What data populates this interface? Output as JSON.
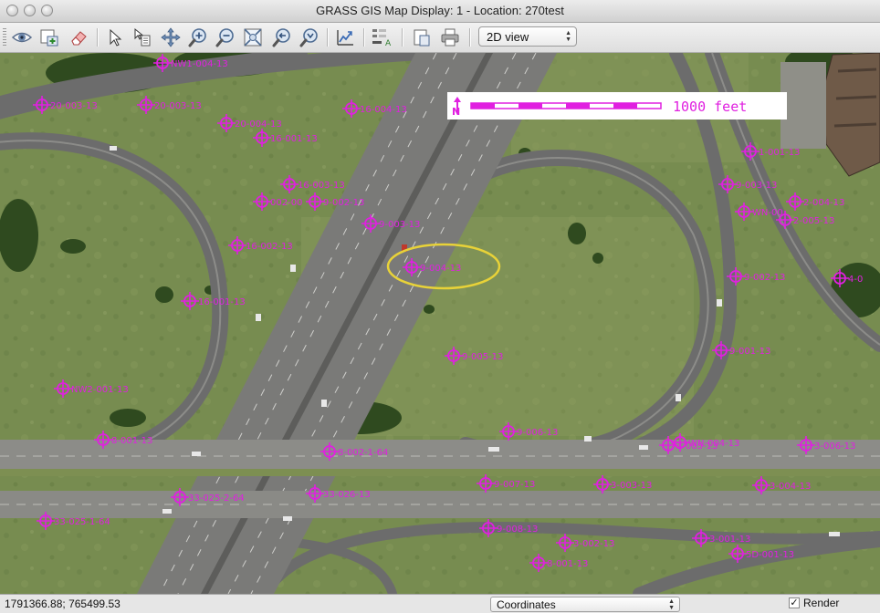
{
  "window": {
    "title": "GRASS GIS Map Display: 1  - Location: 270test"
  },
  "toolbar": {
    "buttons": [
      {
        "name": "display-map-icon"
      },
      {
        "name": "render-map-icon"
      },
      {
        "name": "erase-icon"
      },
      {
        "name": "pointer-icon"
      },
      {
        "name": "query-icon"
      },
      {
        "name": "pan-icon"
      },
      {
        "name": "zoom-in-icon"
      },
      {
        "name": "zoom-out-icon"
      },
      {
        "name": "zoom-extent-icon"
      },
      {
        "name": "zoom-back-icon"
      },
      {
        "name": "zoom-menu-icon"
      },
      {
        "name": "analyze-icon"
      },
      {
        "name": "decoration-icon"
      },
      {
        "name": "save-icon"
      },
      {
        "name": "print-icon"
      }
    ],
    "view_mode": "2D view"
  },
  "map": {
    "scalebar_text": "1000  feet",
    "north_arrow_letter": "N",
    "gcp_color": "#e020e0",
    "highlight_color": "#e8d238",
    "gcp_labels": [
      "NW1-004-13",
      "20-003-13",
      "20-003-13",
      "20-004-13",
      "16-004-13",
      "16-001-13",
      "16-003-13",
      "002-00",
      "9-002-13",
      "9-003-13",
      "16-002-13",
      "9-004-13",
      "16-001-13",
      "9-005-13",
      "NW2-001-13",
      "8-001-13",
      "9-006-13",
      "8-002-1-64",
      "WN-004-13",
      "3-005-13",
      "3-006-13",
      "9-007-13",
      "3-003-13",
      "3-004-13",
      "33-025-2-64",
      "33-026-13",
      "33-025-1-64",
      "9-008-13",
      "3-002-13",
      "3-001-13",
      "8-001-13",
      "5D-001-13",
      "1-001-13",
      "9-003-13",
      "2-004-13",
      "WN-00",
      "2-005-13",
      "9-002-13",
      "4-0",
      "9-001-13"
    ]
  },
  "statusbar": {
    "coordinates": "1791366.88; 765499.53",
    "mode": "Coordinates",
    "render_label": "Render",
    "render_checked": "✓"
  }
}
